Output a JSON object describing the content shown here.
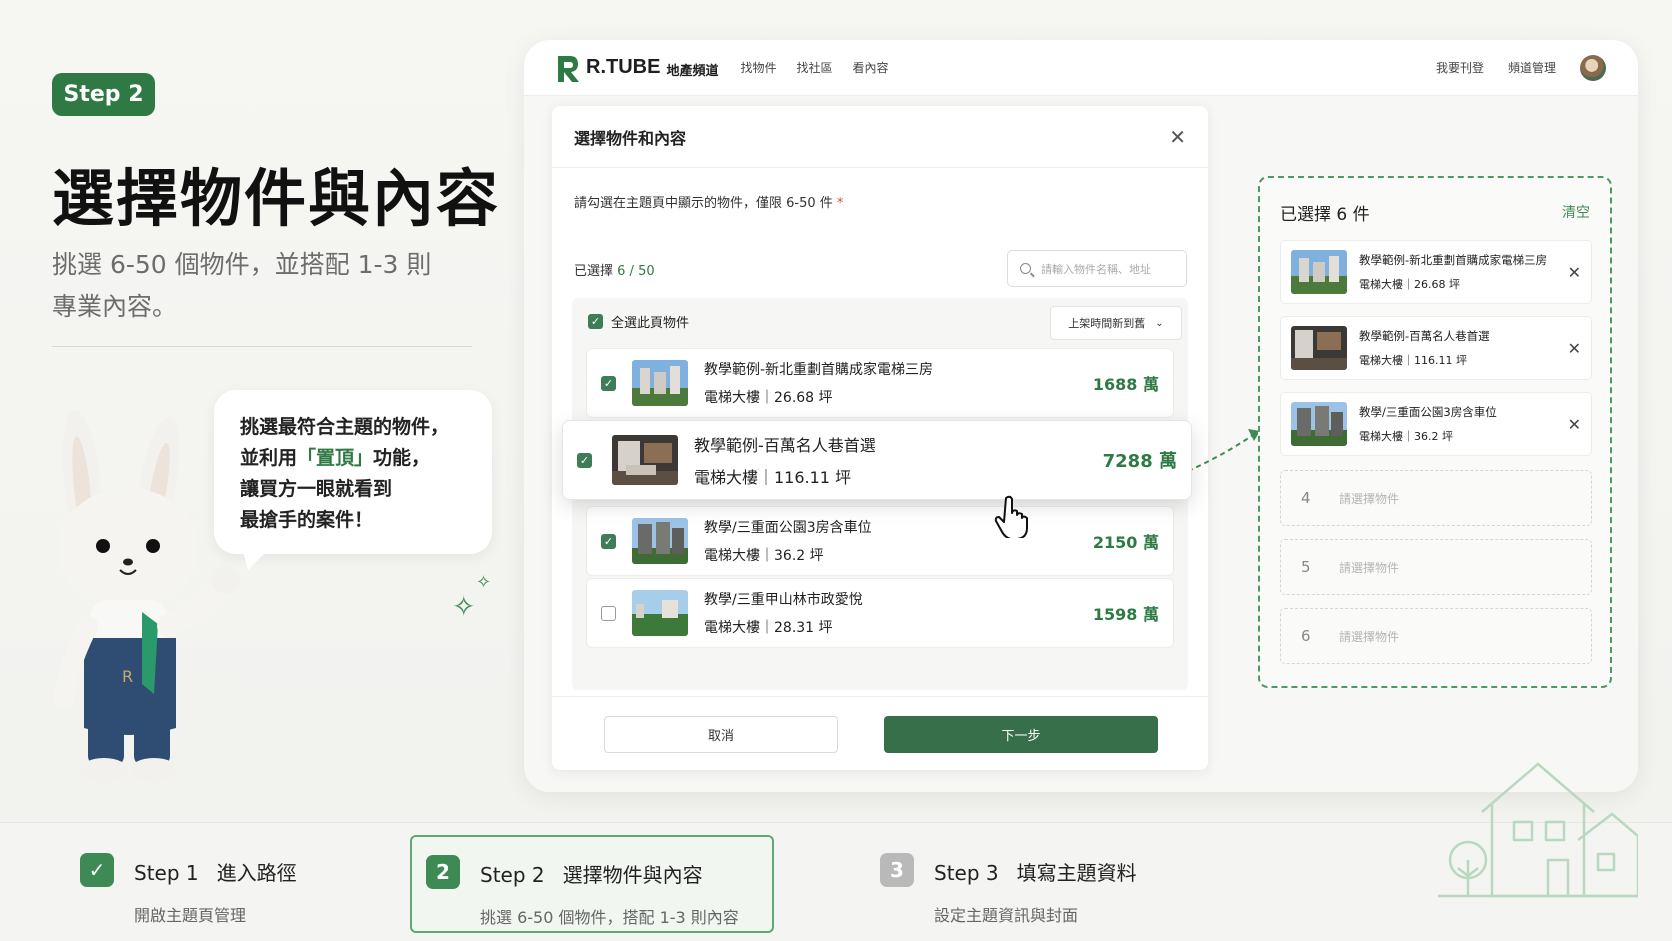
{
  "intro": {
    "step_pill": "Step 2",
    "title": "選擇物件與內容",
    "desc_line1": "挑選 6-50 個物件，並搭配 1-3 則",
    "desc_line2": "專業內容。"
  },
  "bubble": {
    "line1": "挑選最符合主題的物件，",
    "line2_pre": "並利用",
    "line2_hl": "「置頂」",
    "line2_post": "功能，",
    "line3": "讓買方一眼就看到",
    "line4": "最搶手的案件！"
  },
  "topbar": {
    "logo": "R.TUBE",
    "logo_sub": "地產頻道",
    "nav": [
      "找物件",
      "找社區",
      "看內容"
    ],
    "right": [
      "我要刊登",
      "頻道管理"
    ]
  },
  "dialog": {
    "title": "選擇物件和內容",
    "instruction": "請勾選在主題頁中顯示的物件，僅限 6-50 件",
    "required_mark": "*",
    "count_label": "已選擇",
    "count_value": "6 / 50",
    "search_placeholder": "請輸入物件名稱、地址",
    "select_all": "全選此頁物件",
    "sort": "上架時間新到舊",
    "items": [
      {
        "title": "教學範例-新北重劃首購成家電梯三房",
        "sub": "電梯大樓｜26.68 坪",
        "price": "1688 萬",
        "checked": true
      },
      {
        "title": "教學範例-百萬名人巷首選",
        "sub": "電梯大樓｜116.11 坪",
        "price": "7288 萬",
        "checked": true
      },
      {
        "title": "教學/三重面公園3房含車位",
        "sub": "電梯大樓｜36.2 坪",
        "price": "2150 萬",
        "checked": true
      },
      {
        "title": "教學/三重甲山林市政愛悅",
        "sub": "電梯大樓｜28.31 坪",
        "price": "1598 萬",
        "checked": false
      }
    ],
    "cancel": "取消",
    "next": "下一步"
  },
  "selected": {
    "title": "已選擇 6 件",
    "clear": "清空",
    "items": [
      {
        "title": "教學範例-新北重劃首購成家電梯三房",
        "sub": "電梯大樓｜26.68 坪"
      },
      {
        "title": "教學範例-百萬名人巷首選",
        "sub": "電梯大樓｜116.11 坪"
      },
      {
        "title": "教學/三重面公園3房含車位",
        "sub": "電梯大樓｜36.2 坪"
      }
    ],
    "empty": [
      {
        "n": "4",
        "p": "請選擇物件"
      },
      {
        "n": "5",
        "p": "請選擇物件"
      },
      {
        "n": "6",
        "p": "請選擇物件"
      }
    ]
  },
  "steps": [
    {
      "num": "Step 1",
      "label": "進入路徑",
      "sub": "開啟主題頁管理",
      "icon": "check-icon"
    },
    {
      "num": "Step 2",
      "label": "選擇物件與內容",
      "sub": "挑選 6-50 個物件，搭配 1-3 則內容",
      "icon": "2"
    },
    {
      "num": "Step 3",
      "label": "填寫主題資料",
      "sub": "設定主題資訊與封面",
      "icon": "3"
    }
  ],
  "colors": {
    "accent": "#2f7a44",
    "price": "#2f7a44",
    "dashed": "#4b9a62"
  }
}
